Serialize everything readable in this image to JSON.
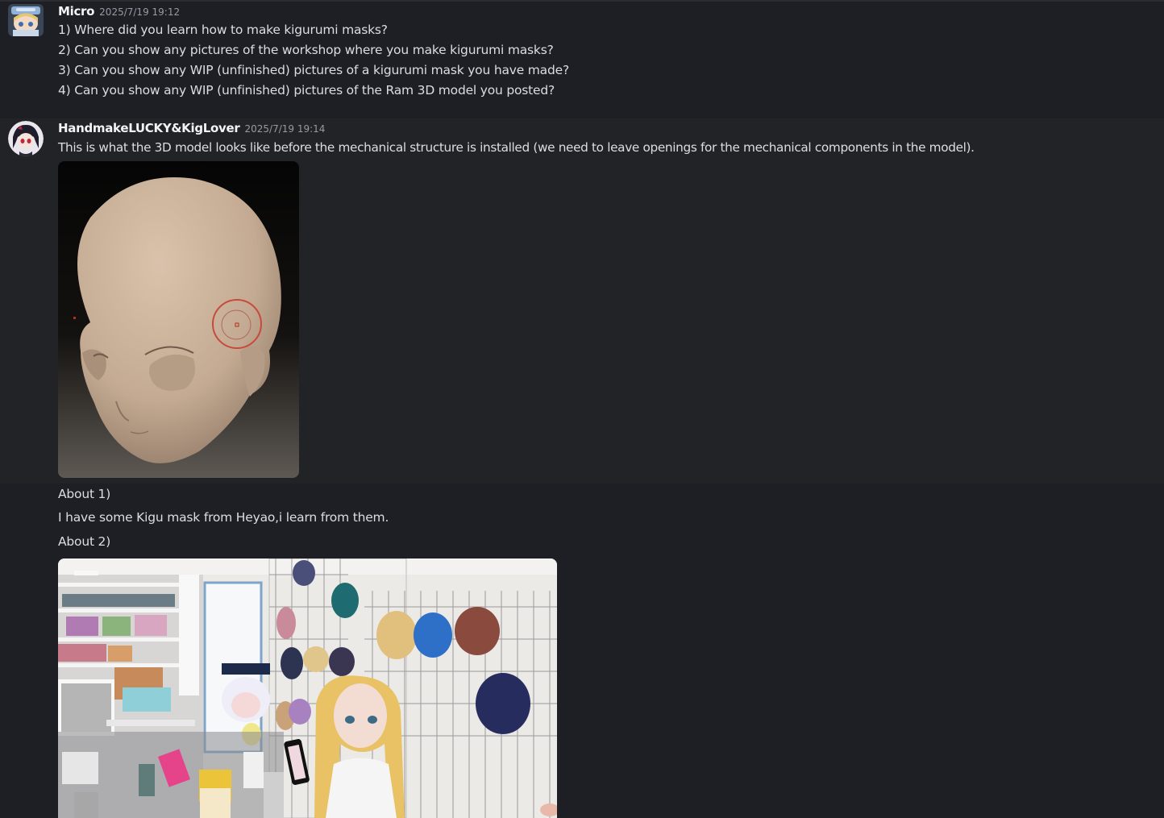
{
  "messages": [
    {
      "author": "Micro",
      "timestamp": "2025/7/19 19:12",
      "lines": [
        "1) Where did you learn how to make kigurumi masks?",
        "2) Can you show any pictures of the workshop where you make kigurumi masks?",
        "3) Can you show any WIP (unfinished) pictures of a kigurumi mask you have made?",
        "4) Can you show any WIP (unfinished) pictures of the Ram 3D model you posted?"
      ]
    },
    {
      "author": "HandmakeLUCKY&KigLover",
      "timestamp": "2025/7/19 19:14",
      "lines": [
        "This is what the 3D model looks like before the mechanical structure is installed (we need to leave openings for the mechanical components in the model)."
      ],
      "attachment": "3d-head-model-image"
    },
    {
      "continuation_lines": [
        "About 1)",
        "I have some Kigu mask from Heyao,i learn from them.",
        "About 2)"
      ],
      "attachment": "workshop-photo"
    }
  ],
  "colors": {
    "background": "#1e1f24",
    "hover_background": "#222327",
    "username": "#f2f3f5",
    "timestamp": "#949ba4",
    "text": "#dbdee1"
  }
}
